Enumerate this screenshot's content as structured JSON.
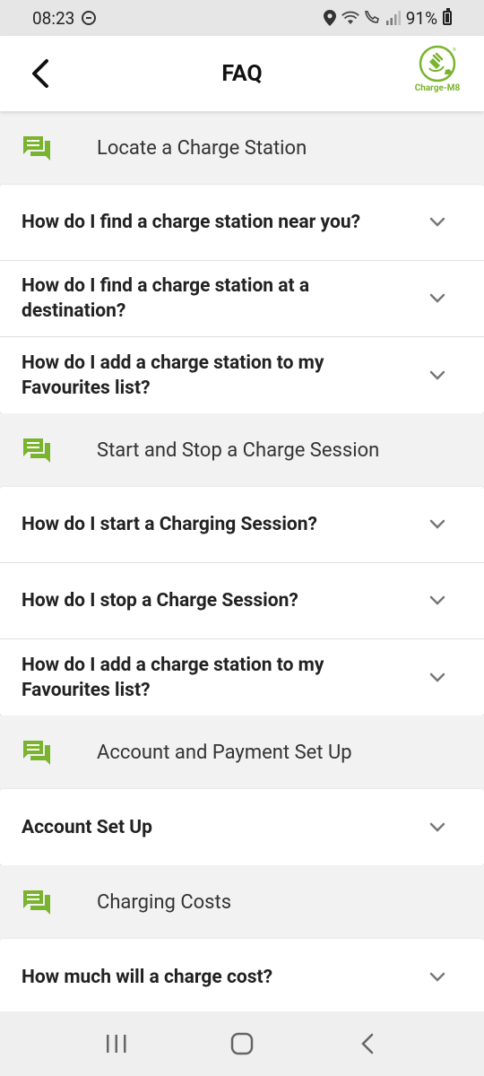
{
  "status_bar": {
    "time": "08:23",
    "battery": "91%",
    "icons": [
      "do-not-disturb-icon",
      "location-icon",
      "wifi-icon",
      "wifi-calling-icon",
      "signal-icon",
      "battery-icon"
    ]
  },
  "header": {
    "title": "FAQ",
    "back_icon": "chevron-left-icon",
    "logo_text": "Charge-M8"
  },
  "colors": {
    "accent": "#7ab32e",
    "card_bg": "#ffffff",
    "page_bg": "#f2f2f2"
  },
  "sections": [
    {
      "label": "Locate a Charge Station",
      "icon": "chat-bubbles-icon",
      "questions": [
        "How do I find a charge station near you?",
        "How do I find a charge station at a destination?",
        "How do I add a charge station to my Favourites list?"
      ]
    },
    {
      "label": "Start and Stop a Charge Session",
      "icon": "chat-bubbles-icon",
      "questions": [
        "How do I start a Charging Session?",
        "How do I stop a Charge Session?",
        "How do I add a charge station to my Favourites list?"
      ]
    },
    {
      "label": "Account and Payment Set Up",
      "icon": "chat-bubbles-icon",
      "questions": [
        "Account Set Up"
      ]
    },
    {
      "label": "Charging Costs",
      "icon": "chat-bubbles-icon",
      "questions": [
        "How much will a charge cost?"
      ]
    }
  ],
  "nav_bar": {
    "buttons": [
      "recent-apps-icon",
      "home-icon",
      "back-icon"
    ]
  }
}
